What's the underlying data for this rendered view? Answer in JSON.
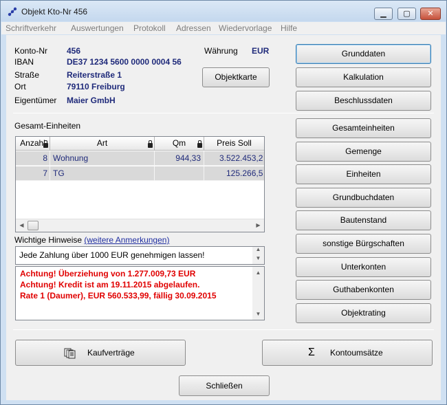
{
  "window": {
    "title": "Objekt Kto-Nr 456",
    "min_icon": "minimize-icon",
    "max_icon": "maximize-icon",
    "close_icon": "close-icon"
  },
  "menu": [
    "Schriftverkehr",
    "Auswertungen",
    "Protokoll",
    "Adressen",
    "Wiedervorlage",
    "Hilfe"
  ],
  "info": {
    "konto_label": "Konto-Nr",
    "konto_value": "456",
    "iban_label": "IBAN",
    "iban_value": "DE37 1234 5600 0000 0004 56",
    "waehrung_label": "Währung",
    "waehrung_value": "EUR",
    "strasse_label": "Straße",
    "strasse_value": "Reiterstraße 1",
    "ort_label": "Ort",
    "ort_value": "79110 Freiburg",
    "eigentuemer_label": "Eigentümer",
    "eigentuemer_value": "Maier GmbH",
    "objektkarte_button": "Objektkarte"
  },
  "units": {
    "label": "Gesamt-Einheiten",
    "columns": [
      "Anzahl",
      "Art",
      "Qm",
      "Preis Soll"
    ],
    "rows": [
      {
        "anzahl": "8",
        "art": "Wohnung",
        "qm": "944,33",
        "preis": "3.522.453,2"
      },
      {
        "anzahl": "7",
        "art": "TG",
        "qm": "",
        "preis": "125.266,5"
      }
    ]
  },
  "hints": {
    "label": "Wichtige Hinweise",
    "link": "(weitere Anmerkungen)",
    "note": "Jede Zahlung über 1000 EUR genehmigen lassen!",
    "warnings": [
      "Achtung! Überziehung von 1.277.009,73 EUR",
      "Achtung! Kredit ist am 19.11.2015 abgelaufen.",
      "Rate 1 (Daumer), EUR 560.533,99, fällig 30.09.2015"
    ]
  },
  "side_buttons": [
    "Grunddaten",
    "Kalkulation",
    "Beschlussdaten",
    "Gesamteinheiten",
    "Gemenge",
    "Einheiten",
    "Grundbuchdaten",
    "Bautenstand",
    "sonstige Bürgschaften",
    "Unterkonten",
    "Guthabenkonten",
    "Objektrating"
  ],
  "bottom": {
    "kaufvertraege_label": "Kaufverträge",
    "kaufvertraege_icon": "documents-icon",
    "kontoumsaetze_label": "Kontoumsätze",
    "kontoumsaetze_icon": "sigma-icon",
    "kontoumsaetze_glyph": "Σ",
    "schliessen_label": "Schließen"
  },
  "colors": {
    "value_text": "#1f2a7a",
    "warning_text": "#e00000",
    "selected_row": "#d9d9d9"
  }
}
